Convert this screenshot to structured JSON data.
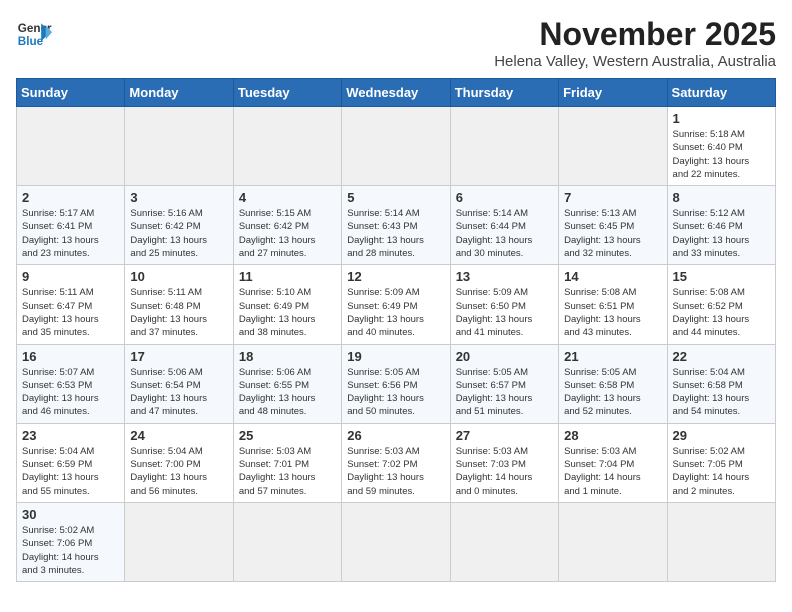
{
  "header": {
    "logo_line1": "General",
    "logo_line2": "Blue",
    "month": "November 2025",
    "location": "Helena Valley, Western Australia, Australia"
  },
  "days_of_week": [
    "Sunday",
    "Monday",
    "Tuesday",
    "Wednesday",
    "Thursday",
    "Friday",
    "Saturday"
  ],
  "weeks": [
    [
      {
        "day": "",
        "info": ""
      },
      {
        "day": "",
        "info": ""
      },
      {
        "day": "",
        "info": ""
      },
      {
        "day": "",
        "info": ""
      },
      {
        "day": "",
        "info": ""
      },
      {
        "day": "",
        "info": ""
      },
      {
        "day": "1",
        "info": "Sunrise: 5:18 AM\nSunset: 6:40 PM\nDaylight: 13 hours\nand 22 minutes."
      }
    ],
    [
      {
        "day": "2",
        "info": "Sunrise: 5:17 AM\nSunset: 6:41 PM\nDaylight: 13 hours\nand 23 minutes."
      },
      {
        "day": "3",
        "info": "Sunrise: 5:16 AM\nSunset: 6:42 PM\nDaylight: 13 hours\nand 25 minutes."
      },
      {
        "day": "4",
        "info": "Sunrise: 5:15 AM\nSunset: 6:42 PM\nDaylight: 13 hours\nand 27 minutes."
      },
      {
        "day": "5",
        "info": "Sunrise: 5:14 AM\nSunset: 6:43 PM\nDaylight: 13 hours\nand 28 minutes."
      },
      {
        "day": "6",
        "info": "Sunrise: 5:14 AM\nSunset: 6:44 PM\nDaylight: 13 hours\nand 30 minutes."
      },
      {
        "day": "7",
        "info": "Sunrise: 5:13 AM\nSunset: 6:45 PM\nDaylight: 13 hours\nand 32 minutes."
      },
      {
        "day": "8",
        "info": "Sunrise: 5:12 AM\nSunset: 6:46 PM\nDaylight: 13 hours\nand 33 minutes."
      }
    ],
    [
      {
        "day": "9",
        "info": "Sunrise: 5:11 AM\nSunset: 6:47 PM\nDaylight: 13 hours\nand 35 minutes."
      },
      {
        "day": "10",
        "info": "Sunrise: 5:11 AM\nSunset: 6:48 PM\nDaylight: 13 hours\nand 37 minutes."
      },
      {
        "day": "11",
        "info": "Sunrise: 5:10 AM\nSunset: 6:49 PM\nDaylight: 13 hours\nand 38 minutes."
      },
      {
        "day": "12",
        "info": "Sunrise: 5:09 AM\nSunset: 6:49 PM\nDaylight: 13 hours\nand 40 minutes."
      },
      {
        "day": "13",
        "info": "Sunrise: 5:09 AM\nSunset: 6:50 PM\nDaylight: 13 hours\nand 41 minutes."
      },
      {
        "day": "14",
        "info": "Sunrise: 5:08 AM\nSunset: 6:51 PM\nDaylight: 13 hours\nand 43 minutes."
      },
      {
        "day": "15",
        "info": "Sunrise: 5:08 AM\nSunset: 6:52 PM\nDaylight: 13 hours\nand 44 minutes."
      }
    ],
    [
      {
        "day": "16",
        "info": "Sunrise: 5:07 AM\nSunset: 6:53 PM\nDaylight: 13 hours\nand 46 minutes."
      },
      {
        "day": "17",
        "info": "Sunrise: 5:06 AM\nSunset: 6:54 PM\nDaylight: 13 hours\nand 47 minutes."
      },
      {
        "day": "18",
        "info": "Sunrise: 5:06 AM\nSunset: 6:55 PM\nDaylight: 13 hours\nand 48 minutes."
      },
      {
        "day": "19",
        "info": "Sunrise: 5:05 AM\nSunset: 6:56 PM\nDaylight: 13 hours\nand 50 minutes."
      },
      {
        "day": "20",
        "info": "Sunrise: 5:05 AM\nSunset: 6:57 PM\nDaylight: 13 hours\nand 51 minutes."
      },
      {
        "day": "21",
        "info": "Sunrise: 5:05 AM\nSunset: 6:58 PM\nDaylight: 13 hours\nand 52 minutes."
      },
      {
        "day": "22",
        "info": "Sunrise: 5:04 AM\nSunset: 6:58 PM\nDaylight: 13 hours\nand 54 minutes."
      }
    ],
    [
      {
        "day": "23",
        "info": "Sunrise: 5:04 AM\nSunset: 6:59 PM\nDaylight: 13 hours\nand 55 minutes."
      },
      {
        "day": "24",
        "info": "Sunrise: 5:04 AM\nSunset: 7:00 PM\nDaylight: 13 hours\nand 56 minutes."
      },
      {
        "day": "25",
        "info": "Sunrise: 5:03 AM\nSunset: 7:01 PM\nDaylight: 13 hours\nand 57 minutes."
      },
      {
        "day": "26",
        "info": "Sunrise: 5:03 AM\nSunset: 7:02 PM\nDaylight: 13 hours\nand 59 minutes."
      },
      {
        "day": "27",
        "info": "Sunrise: 5:03 AM\nSunset: 7:03 PM\nDaylight: 14 hours\nand 0 minutes."
      },
      {
        "day": "28",
        "info": "Sunrise: 5:03 AM\nSunset: 7:04 PM\nDaylight: 14 hours\nand 1 minute."
      },
      {
        "day": "29",
        "info": "Sunrise: 5:02 AM\nSunset: 7:05 PM\nDaylight: 14 hours\nand 2 minutes."
      }
    ],
    [
      {
        "day": "30",
        "info": "Sunrise: 5:02 AM\nSunset: 7:06 PM\nDaylight: 14 hours\nand 3 minutes."
      },
      {
        "day": "",
        "info": ""
      },
      {
        "day": "",
        "info": ""
      },
      {
        "day": "",
        "info": ""
      },
      {
        "day": "",
        "info": ""
      },
      {
        "day": "",
        "info": ""
      },
      {
        "day": "",
        "info": ""
      }
    ]
  ]
}
